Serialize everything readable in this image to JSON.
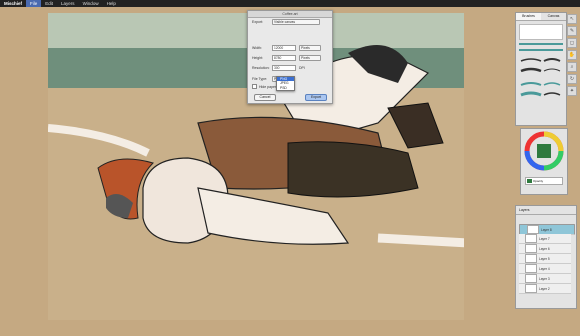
{
  "menubar": {
    "app": "Mischief",
    "items": [
      "File",
      "Edit",
      "Layers",
      "Window",
      "Help"
    ]
  },
  "dialog": {
    "title": "Coffee.art",
    "export_label": "Export:",
    "export_value": "Visible canvas",
    "width_label": "Width:",
    "width_value": "12000",
    "width_unit": "Pixels",
    "height_label": "Height:",
    "height_value": "8780",
    "height_unit": "Pixels",
    "resolution_label": "Resolution:",
    "resolution_value": "300",
    "resolution_unit": "DPI",
    "filetype_label": "File Type:",
    "filetype_value": "PNG",
    "hide_label": "Hide paper",
    "cancel": "Cancel",
    "export_btn": "Export",
    "filetype_options": [
      "PNG",
      "JPEG",
      "PSD"
    ]
  },
  "brush_panel": {
    "tabs": [
      "Brushes",
      "Canvas"
    ]
  },
  "layers_panel": {
    "title": "Layers",
    "items": [
      "Layer 8",
      "Layer 7",
      "Layer 6",
      "Layer 5",
      "Layer 4",
      "Layer 3",
      "Layer 2"
    ]
  },
  "color_panel": {
    "swatch": "#2f7a3f",
    "name": "Opacity"
  },
  "colors": {
    "accent": "#3b6fd1",
    "menubar": "#222222",
    "background": "#c5a982"
  }
}
